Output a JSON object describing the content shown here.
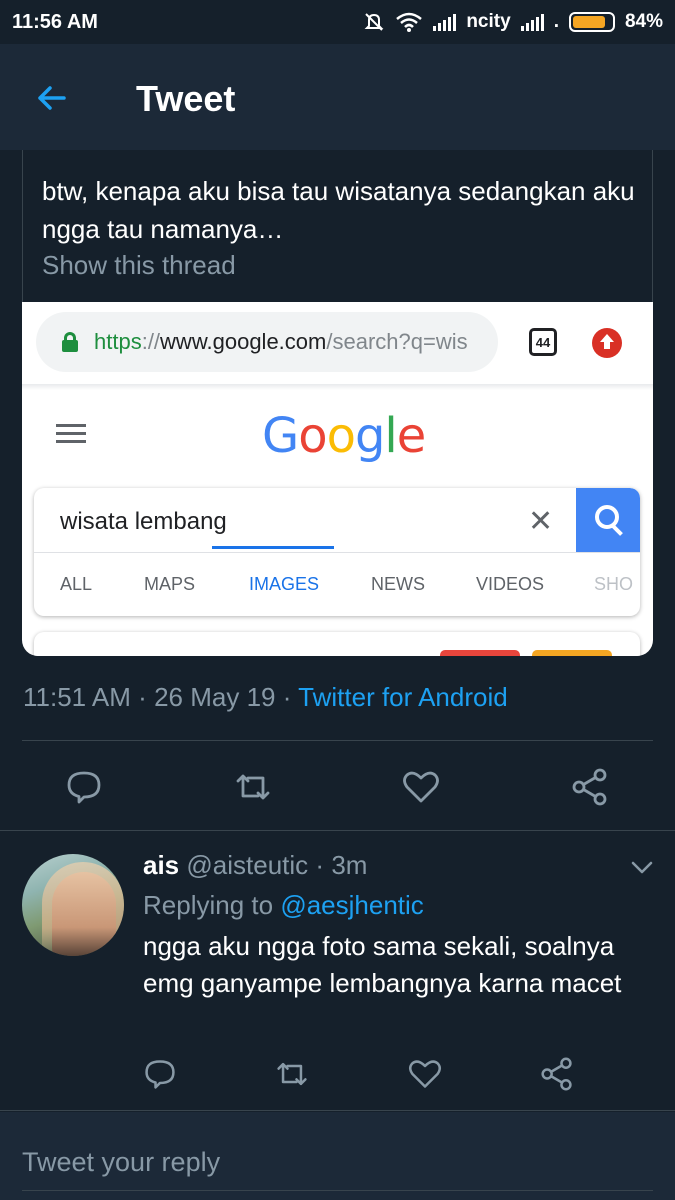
{
  "status_bar": {
    "time": "11:56 AM",
    "carrier": "ncity",
    "dot": ".",
    "battery": "84%",
    "battery_level": 0.84
  },
  "header": {
    "title": "Tweet"
  },
  "tweet": {
    "text": "btw, kenapa aku bisa tau wisatanya sedangkan aku ngga tau namanya…",
    "show_thread": "Show this thread",
    "time": "11:51 AM",
    "separator": "·",
    "date": "26 May 19",
    "source": "Twitter for Android"
  },
  "media": {
    "url_scheme": "https",
    "url_sep": "://",
    "url_host": "www.google.com",
    "url_path": "/search?q=wis",
    "tab_count": "44",
    "google_logo": "Google",
    "query": "wisata lembang",
    "tabs": [
      "ALL",
      "MAPS",
      "IMAGES",
      "NEWS",
      "VIDEOS",
      "SHO"
    ],
    "active_tab": "IMAGES"
  },
  "reply": {
    "name": "ais",
    "handle": "@aisteutic",
    "separator": "·",
    "time": "3m",
    "replying_to_label": "Replying to",
    "replying_to": "@aesjhentic",
    "text": "ngga aku ngga foto sama sekali, soalnya emg ganyampe lembangnya karna macet"
  },
  "compose": {
    "placeholder": "Tweet your reply"
  },
  "colors": {
    "background": "#15202b",
    "header": "#1c2938",
    "accent": "#1da1f2",
    "secondary_text": "#8899a6",
    "divider": "#38444d"
  },
  "icons": [
    "back-arrow-icon",
    "reply-icon",
    "retweet-icon",
    "like-icon",
    "share-icon",
    "chevron-down-icon",
    "lock-icon",
    "hamburger-icon",
    "clear-icon",
    "search-icon"
  ]
}
